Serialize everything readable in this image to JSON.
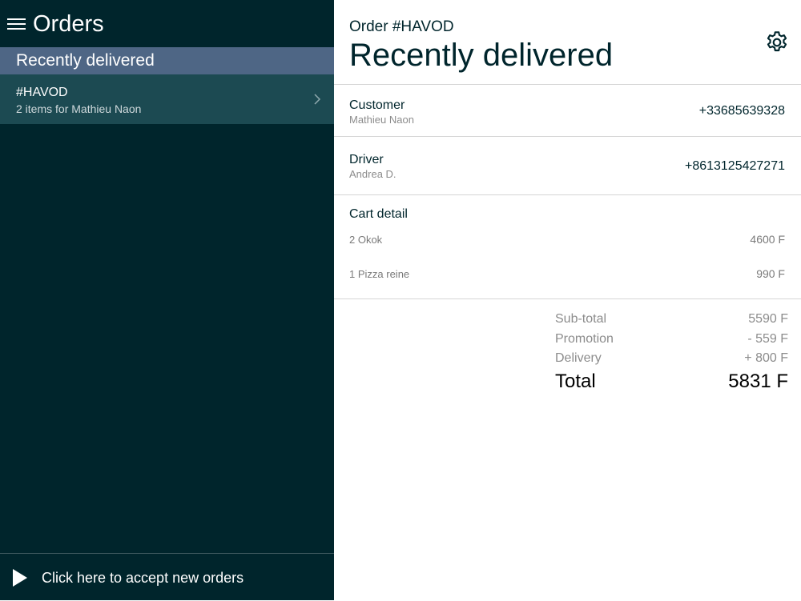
{
  "colors": {
    "sidebar_bg": "#00252c",
    "section_header_bg": "#4e6685",
    "selected_item_bg": "#1c4a52",
    "text_dark": "#00252c",
    "muted": "#8c8c8c"
  },
  "sidebar": {
    "menu_icon": "hamburger-menu-icon",
    "title": "Orders",
    "section_title": "Recently delivered",
    "orders": [
      {
        "code": "#HAVOD",
        "subtitle": "2 items for Mathieu Naon",
        "icon": "chevron-right-icon"
      }
    ],
    "accept": {
      "icon": "play-icon",
      "label": "Click here to accept new orders"
    }
  },
  "main": {
    "order_number": "Order #HAVOD",
    "title": "Recently delivered",
    "settings_icon": "gear-icon",
    "customer": {
      "label": "Customer",
      "name": "Mathieu Naon",
      "phone": "+33685639328"
    },
    "driver": {
      "label": "Driver",
      "name": "Andrea D.",
      "phone": "+8613125427271"
    },
    "cart": {
      "title": "Cart detail",
      "items": [
        {
          "name": "2 Okok",
          "price": "4600 F"
        },
        {
          "name": "1 Pizza reine",
          "price": "990 F"
        }
      ]
    },
    "summary": {
      "subtotal_label": "Sub-total",
      "subtotal_value": "5590 F",
      "promotion_label": "Promotion",
      "promotion_value": "- 559 F",
      "delivery_label": "Delivery",
      "delivery_value": "+ 800 F",
      "total_label": "Total",
      "total_value": "5831 F"
    }
  }
}
